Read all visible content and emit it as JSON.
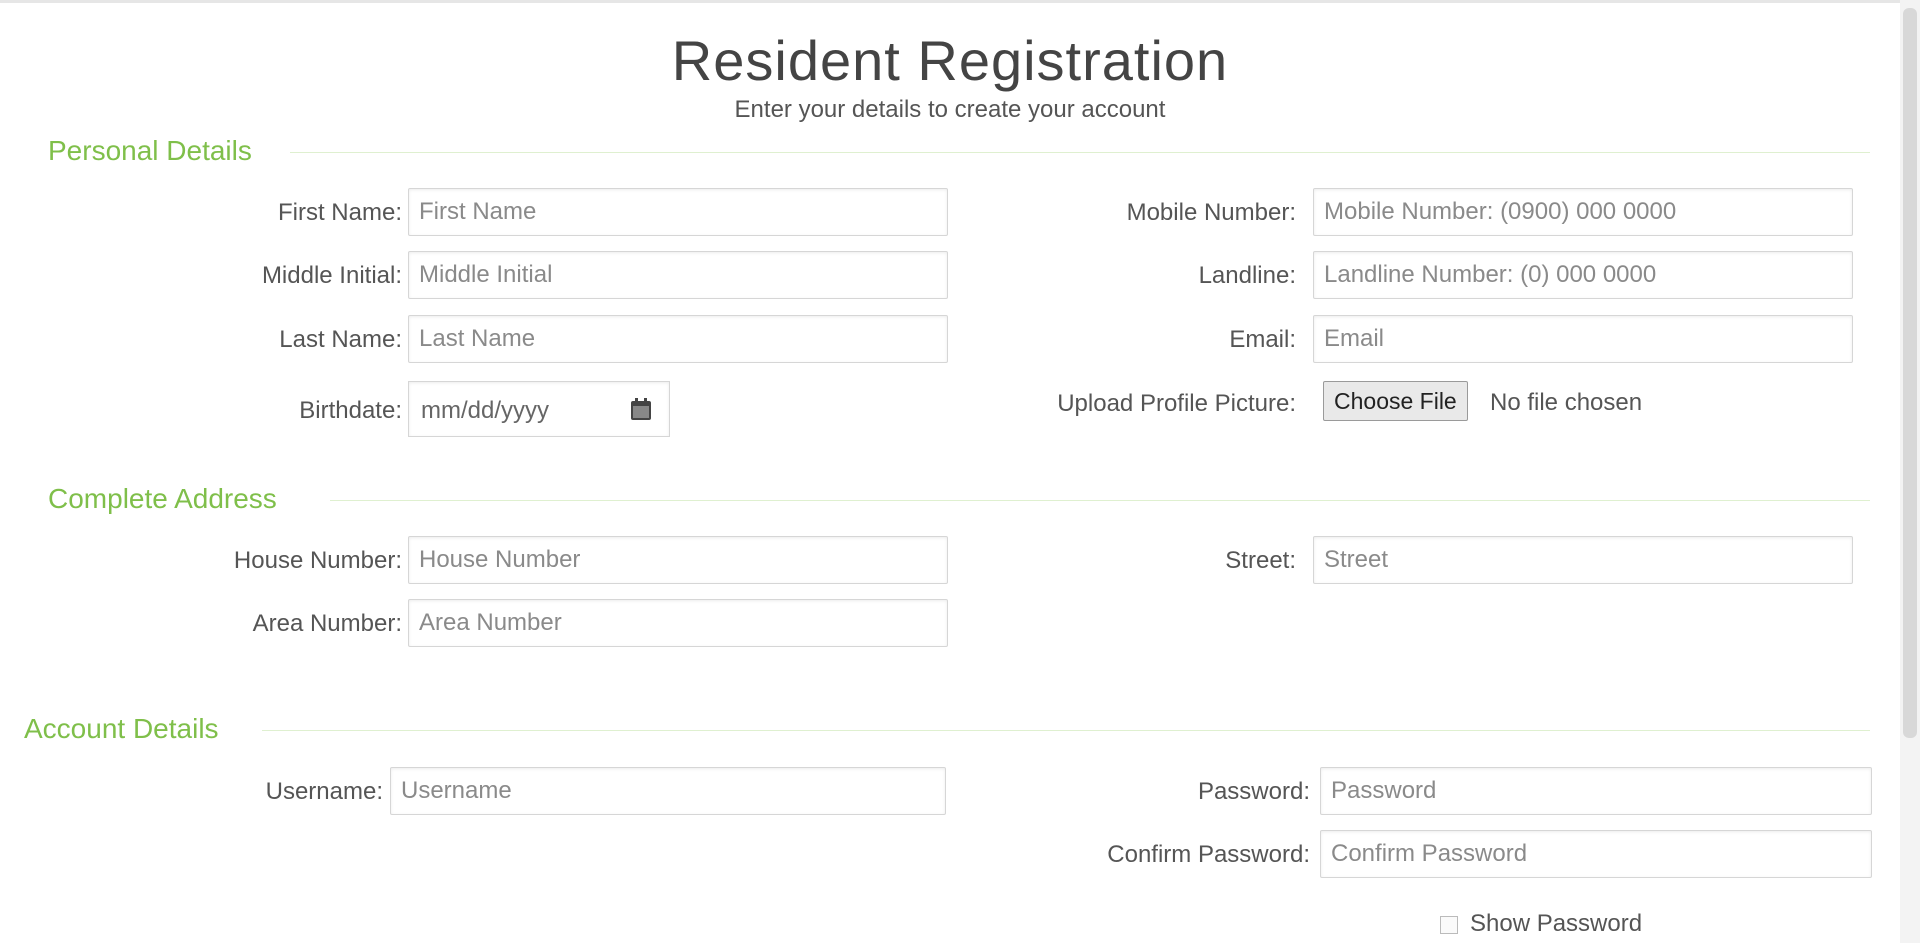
{
  "header": {
    "title": "Resident Registration",
    "subtitle": "Enter your details to create your account"
  },
  "personal": {
    "section_title": "Personal Details",
    "first_name": {
      "label": "First Name:",
      "placeholder": "First Name"
    },
    "middle_initial": {
      "label": "Middle Initial:",
      "placeholder": "Middle Initial"
    },
    "last_name": {
      "label": "Last Name:",
      "placeholder": "Last Name"
    },
    "birthdate": {
      "label": "Birthdate:",
      "placeholder": "mm/dd/yyyy",
      "icon": "calendar-icon"
    },
    "mobile": {
      "label": "Mobile Number:",
      "placeholder": "Mobile Number: (0900) 000 0000"
    },
    "landline": {
      "label": "Landline:",
      "placeholder": "Landline Number: (0) 000 0000"
    },
    "email": {
      "label": "Email:",
      "placeholder": "Email"
    },
    "profile_picture": {
      "label": "Upload Profile Picture:",
      "button": "Choose File",
      "status": "No file chosen"
    }
  },
  "address": {
    "section_title": "Complete Address",
    "house_number": {
      "label": "House Number:",
      "placeholder": "House Number"
    },
    "area_number": {
      "label": "Area Number:",
      "placeholder": "Area Number"
    },
    "street": {
      "label": "Street:",
      "placeholder": "Street"
    }
  },
  "account": {
    "section_title": "Account Details",
    "username": {
      "label": "Username:",
      "placeholder": "Username"
    },
    "password": {
      "label": "Password:",
      "placeholder": "Password"
    },
    "confirm_password": {
      "label": "Confirm Password:",
      "placeholder": "Confirm Password"
    },
    "show_password": "Show Password"
  },
  "colors": {
    "accent": "#7fbf4a",
    "section_line": "#dff0d0",
    "border": "#d6d6d6"
  }
}
